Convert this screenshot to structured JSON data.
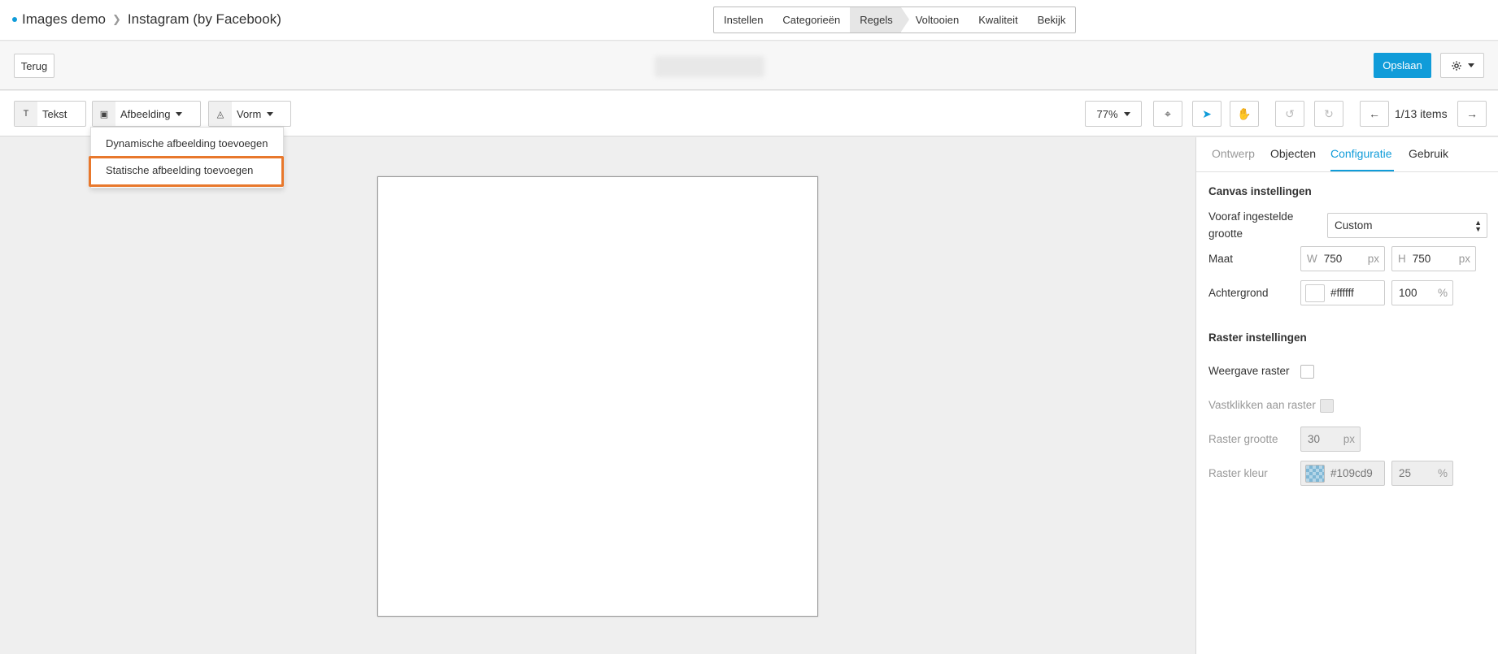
{
  "breadcrumb": {
    "root": "Images demo",
    "current": "Instagram (by Facebook)"
  },
  "steps": [
    "Instellen",
    "Categorieën",
    "Regels",
    "Voltooien",
    "Kwaliteit",
    "Bekijk"
  ],
  "header": {
    "back_label": "Terug",
    "save_label": "Opslaan"
  },
  "toolbar": {
    "text_label": "Tekst",
    "image_label": "Afbeelding",
    "shape_label": "Vorm",
    "zoom": "77%",
    "items": "1/13 items"
  },
  "image_menu": {
    "items": [
      "Dynamische afbeelding toevoegen",
      "Statische afbeelding toevoegen"
    ]
  },
  "panel": {
    "tabs": [
      "Ontwerp",
      "Objecten",
      "Configuratie",
      "Gebruik"
    ],
    "canvas": {
      "title": "Canvas instellingen",
      "preset_label": "Vooraf ingestelde grootte",
      "preset_value": "Custom",
      "size_label": "Maat",
      "w_prefix": "W",
      "w_value": "750",
      "h_prefix": "H",
      "h_value": "750",
      "unit_px": "px",
      "bg_label": "Achtergrond",
      "bg_color": "#ffffff",
      "bg_opacity": "100",
      "unit_pct": "%"
    },
    "grid": {
      "title": "Raster instellingen",
      "show_label": "Weergave raster",
      "snap_label": "Vastklikken aan raster",
      "size_label": "Raster grootte",
      "size_value": "30",
      "unit_px": "px",
      "color_label": "Raster kleur",
      "color_value": "#109cd9",
      "opacity_value": "25",
      "unit_pct": "%"
    }
  }
}
